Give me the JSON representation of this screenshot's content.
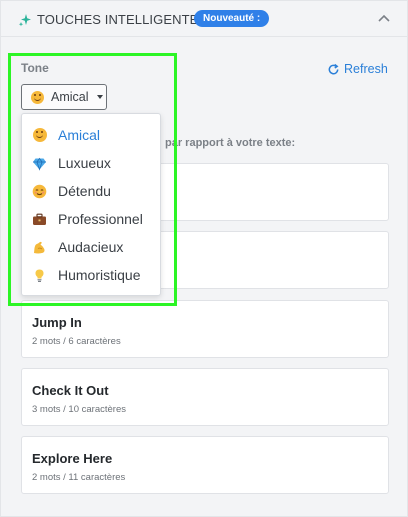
{
  "header": {
    "title": "TOUCHES INTELLIGENTES",
    "badge": "Nouveauté :"
  },
  "tone": {
    "label": "Tone",
    "selected": "Amical",
    "options": [
      {
        "label": "Amical",
        "icon": "smile-icon",
        "selected": true
      },
      {
        "label": "Luxueux",
        "icon": "gem-icon",
        "selected": false
      },
      {
        "label": "Détendu",
        "icon": "relieved-face-icon",
        "selected": false
      },
      {
        "label": "Professionnel",
        "icon": "briefcase-icon",
        "selected": false
      },
      {
        "label": "Audacieux",
        "icon": "flexed-biceps-icon",
        "selected": false
      },
      {
        "label": "Humoristique",
        "icon": "light-bulb-icon",
        "selected": false
      }
    ]
  },
  "refresh_label": "Refresh",
  "intro_text": "par rapport à votre texte:",
  "suggestions": [
    {
      "title": "Jump In",
      "meta": "2 mots / 6 caractères"
    },
    {
      "title": "Check It Out",
      "meta": "3 mots / 10 caractères"
    },
    {
      "title": "Explore Here",
      "meta": "2 mots / 11 caractères"
    }
  ],
  "colors": {
    "accent": "#2a7fd8",
    "badge": "#2f80e8",
    "highlight": "#2cf525",
    "background": "#f3f4f6"
  }
}
